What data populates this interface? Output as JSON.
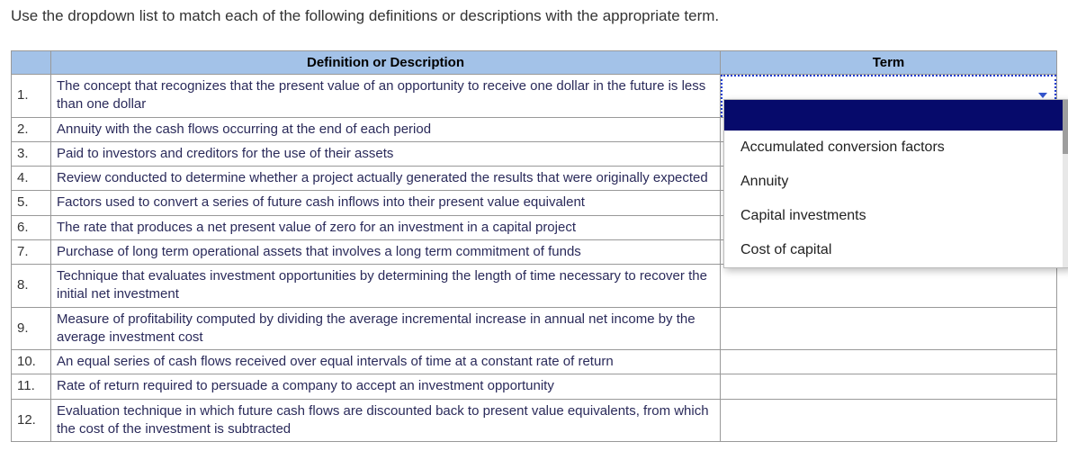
{
  "instruction": "Use the dropdown list to match each of the following definitions or descriptions with the appropriate term.",
  "headers": {
    "definition": "Definition or Description",
    "term": "Term"
  },
  "rows": [
    {
      "num": "1.",
      "definition": "The concept that recognizes that the present value of an opportunity to receive one dollar in the future is less than one dollar",
      "term": ""
    },
    {
      "num": "2.",
      "definition": "Annuity with the cash flows occurring at the end of each period",
      "term": ""
    },
    {
      "num": "3.",
      "definition": "Paid to investors and creditors for the use of their assets",
      "term": ""
    },
    {
      "num": "4.",
      "definition": "Review conducted to determine whether a project actually generated the results that were originally expected",
      "term": ""
    },
    {
      "num": "5.",
      "definition": "Factors used to convert a series of future cash inflows into their present value equivalent",
      "term": ""
    },
    {
      "num": "6.",
      "definition": "The rate that produces a net present value of zero for an investment in a capital project",
      "term": ""
    },
    {
      "num": "7.",
      "definition": "Purchase of long term operational assets that involves a long term commitment of funds",
      "term": ""
    },
    {
      "num": "8.",
      "definition": "Technique that evaluates investment opportunities by determining the length of time necessary to recover the initial net investment",
      "term": ""
    },
    {
      "num": "9.",
      "definition": "Measure of profitability computed by dividing the average incremental increase in annual net income by the average investment cost",
      "term": ""
    },
    {
      "num": "10.",
      "definition": "An equal series of cash flows received over equal intervals of time at a constant rate of return",
      "term": ""
    },
    {
      "num": "11.",
      "definition": "Rate of return required to persuade a company to accept an investment opportunity",
      "term": ""
    },
    {
      "num": "12.",
      "definition": "Evaluation technique in which future cash flows are discounted back to present value equivalents, from which the cost of the investment is subtracted",
      "term": ""
    }
  ],
  "dropdown": {
    "selected": "",
    "options": [
      "",
      "Accumulated conversion factors",
      "Annuity",
      "Capital investments",
      "Cost of capital"
    ]
  }
}
